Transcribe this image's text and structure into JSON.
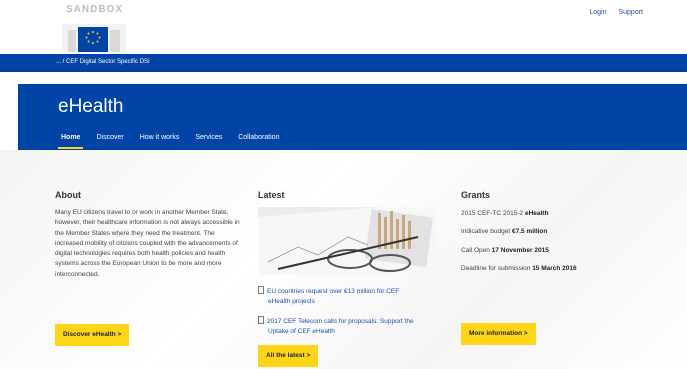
{
  "header": {
    "brand": "SANDBOX",
    "login": "Login",
    "support": "Support"
  },
  "breadcrumb": "... / CEF Digital Sector Specific DSI",
  "site": {
    "title": "eHealth",
    "nav": [
      "Home",
      "Discover",
      "How it works",
      "Services",
      "Collaboration"
    ]
  },
  "about": {
    "heading": "About",
    "text": "Many EU citizens travel to or work in another Member State, however, their healthcare information is not always accessible in the Member States where they need the treatment. The increased mobility of citizens coupled with the advancements of digital technologies requires both health policies and health systems across the European Union to be more and more interconnected.",
    "button": "Discover eHealth  >"
  },
  "latest": {
    "heading": "Latest",
    "items": [
      {
        "title_line1": "EU countries request over €13 million for CEF",
        "title_line2": "eHealth projects"
      },
      {
        "title_line1": "2017 CEF Telecom calls for proposals: Support the",
        "title_line2": "Uptake of CEF eHealth"
      }
    ],
    "button": "All the latest  >"
  },
  "grants": {
    "heading": "Grants",
    "call_id": "2015 CEF-TC 2015-2",
    "call_name": "eHealth",
    "budget_label": "Indicative budget",
    "budget_value": "€7.5 million",
    "open_label": "Call Open",
    "open_value": "17 November 2015",
    "deadline_label": "Deadline for submission",
    "deadline_value": "15 March 2016",
    "button": "More information  >"
  },
  "colors": {
    "primary_blue": "#0044a6",
    "accent_yellow": "#ffd617",
    "link_blue": "#1e4fa8"
  }
}
